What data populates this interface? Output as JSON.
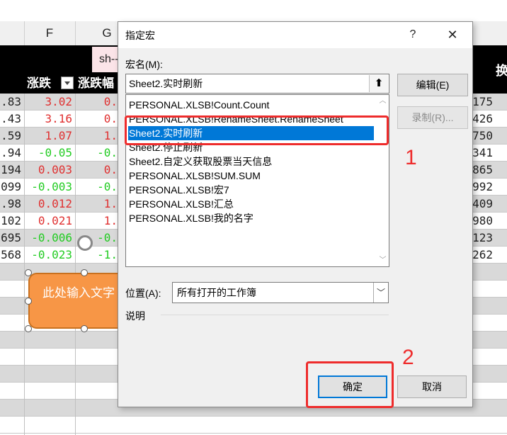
{
  "sheet": {
    "col_headers": [
      "F",
      "G"
    ],
    "sh_label": "sh--",
    "headers": [
      "涨跌",
      "涨跌幅"
    ],
    "right_header_char": "换",
    "rows": [
      {
        "e": ".83",
        "f": "3.02",
        "g": "0.",
        "k": "175",
        "color": "#e03030"
      },
      {
        "e": ".43",
        "f": "3.16",
        "g": "0.",
        "k": "426",
        "color": "#e03030"
      },
      {
        "e": ".59",
        "f": "1.07",
        "g": "1.",
        "k": "750",
        "color": "#e03030"
      },
      {
        "e": ".94",
        "f": "-0.05",
        "g": "-0.",
        "k": "341",
        "color": "#22cc22"
      },
      {
        "e": "194",
        "f": "0.003",
        "g": "0.",
        "k": "865",
        "color": "#e03030"
      },
      {
        "e": "099",
        "f": "-0.003",
        "g": "-0.",
        "k": "992",
        "color": "#22cc22"
      },
      {
        "e": ".98",
        "f": "0.012",
        "g": "1.",
        "k": "409",
        "color": "#e03030"
      },
      {
        "e": "102",
        "f": "0.021",
        "g": "1.",
        "k": "980",
        "color": "#e03030"
      },
      {
        "e": "695",
        "f": "-0.006",
        "g": "-0.",
        "k": "123",
        "color": "#22cc22"
      },
      {
        "e": "568",
        "f": "-0.023",
        "g": "-1.",
        "k": "262",
        "color": "#22cc22"
      }
    ],
    "shape_text": "此处输入文字"
  },
  "dialog": {
    "title": "指定宏",
    "help": "?",
    "close": "✕",
    "macro_name_label": "宏名(M):",
    "macro_name_value": "Sheet2.实时刷新",
    "up_icon": "⬆",
    "macros": [
      "PERSONAL.XLSB!Count.Count",
      "PERSONAL.XLSB!RenameSheet.RenameSheet",
      "Sheet2.实时刷新",
      "Sheet2.停止刷新",
      "Sheet2.自定义获取股票当天信息",
      "PERSONAL.XLSB!SUM.SUM",
      "PERSONAL.XLSB!宏7",
      "PERSONAL.XLSB!汇总",
      "PERSONAL.XLSB!我的名字"
    ],
    "selected_index": 2,
    "edit_label": "编辑(E)",
    "record_label": "录制(R)...",
    "location_label": "位置(A):",
    "location_value": "所有打开的工作簿",
    "description_label": "说明",
    "ok_label": "确定",
    "cancel_label": "取消"
  },
  "annotations": {
    "one": "1",
    "two": "2",
    "color": "#ee2c2c"
  }
}
